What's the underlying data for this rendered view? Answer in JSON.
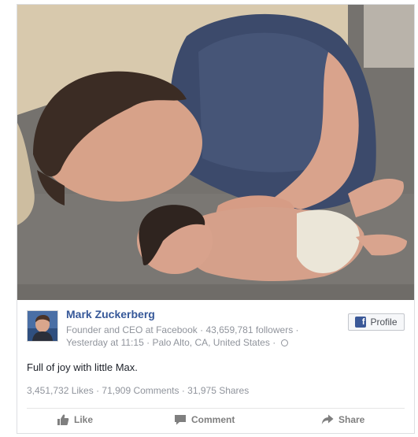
{
  "post": {
    "author_name": "Mark Zuckerberg",
    "author_title": "Founder and CEO at Facebook",
    "separator": "·",
    "followers": "43,659,781 followers",
    "timestamp": "Yesterday at 11:15",
    "location": "Palo Alto, CA, United States",
    "text": "Full of joy with little Max."
  },
  "header": {
    "profile_button_label": "Profile",
    "profile_button_icon": "facebook-f-icon"
  },
  "stats": {
    "likes": "3,451,732 Likes",
    "comments": "71,909 Comments",
    "shares": "31,975 Shares"
  },
  "actions": {
    "like_label": "Like",
    "comment_label": "Comment",
    "share_label": "Share",
    "like_icon": "thumbs-up-icon",
    "comment_icon": "speech-bubble-icon",
    "share_icon": "share-arrow-icon"
  },
  "colors": {
    "link_blue": "#365899",
    "facebook_blue": "#3b5998",
    "meta_gray": "#90949c",
    "text_dark": "#1d2129"
  }
}
